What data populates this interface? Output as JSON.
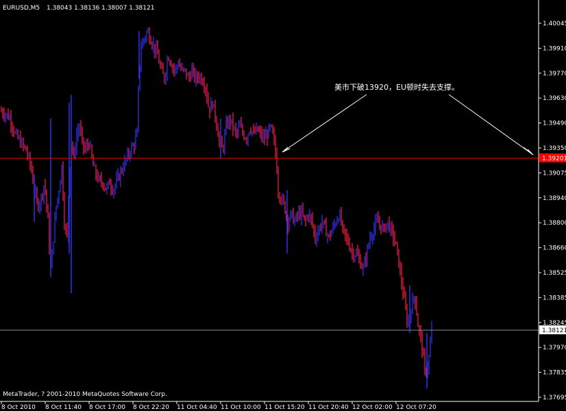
{
  "chart_data": {
    "type": "candlestick",
    "header": {
      "symbol": "EURUSD,M5",
      "quote": "1.38043 1.38136 1.38007 1.38121"
    },
    "ylim": [
      1.37695,
      1.4011
    ],
    "y_ticks": [
      "1.40045",
      "1.39910",
      "1.39770",
      "1.39630",
      "1.39490",
      "1.39350",
      "1.39075",
      "1.38940",
      "1.38800",
      "1.38660",
      "1.38525",
      "1.38385",
      "1.38245",
      "1.37970",
      "1.37835",
      "1.37695"
    ],
    "x_ticks": [
      "8 Oct 2010",
      "8 Oct 11:40",
      "8 Oct 17:00",
      "8 Oct 22:20",
      "11 Oct 04:40",
      "11 Oct 10:00",
      "11 Oct 15:20",
      "11 Oct 20:40",
      "12 Oct 02:00",
      "12 Oct 07:20"
    ],
    "support_level": {
      "value": 1.392,
      "label": "1.39201"
    },
    "current_price": {
      "value": 1.38121,
      "label": "1.38121"
    },
    "annotation": "美市下破13920，EU顿时失去支撑。",
    "copyright": "MetaTrader, ? 2001-2010 MetaQuotes Software Corp.",
    "price_path": [
      [
        0,
        1.395
      ],
      [
        8,
        1.3948
      ],
      [
        15,
        1.3945
      ],
      [
        22,
        1.3935
      ],
      [
        30,
        1.393
      ],
      [
        38,
        1.3925
      ],
      [
        45,
        1.3915
      ],
      [
        50,
        1.39
      ],
      [
        55,
        1.389
      ],
      [
        60,
        1.3895
      ],
      [
        65,
        1.3905
      ],
      [
        70,
        1.388
      ],
      [
        74,
        1.385
      ],
      [
        78,
        1.387
      ],
      [
        82,
        1.389
      ],
      [
        86,
        1.39
      ],
      [
        90,
        1.3915
      ],
      [
        94,
        1.388
      ],
      [
        98,
        1.387
      ],
      [
        101,
        1.391
      ],
      [
        104,
        1.393
      ],
      [
        108,
        1.392
      ],
      [
        112,
        1.3935
      ],
      [
        116,
        1.394
      ],
      [
        120,
        1.393
      ],
      [
        124,
        1.3925
      ],
      [
        130,
        1.393
      ],
      [
        136,
        1.3915
      ],
      [
        140,
        1.391
      ],
      [
        145,
        1.3905
      ],
      [
        150,
        1.3905
      ],
      [
        155,
        1.39
      ],
      [
        160,
        1.3905
      ],
      [
        165,
        1.39
      ],
      [
        170,
        1.3905
      ],
      [
        175,
        1.391
      ],
      [
        180,
        1.3915
      ],
      [
        185,
        1.392
      ],
      [
        190,
        1.3925
      ],
      [
        195,
        1.3928
      ],
      [
        200,
        1.3935
      ],
      [
        203,
        1.3975
      ],
      [
        206,
        1.399
      ],
      [
        210,
        1.3995
      ],
      [
        215,
        1.4
      ],
      [
        220,
        1.3995
      ],
      [
        225,
        1.399
      ],
      [
        230,
        1.3985
      ],
      [
        235,
        1.3975
      ],
      [
        240,
        1.397
      ],
      [
        245,
        1.3985
      ],
      [
        250,
        1.398
      ],
      [
        255,
        1.3975
      ],
      [
        260,
        1.398
      ],
      [
        265,
        1.3975
      ],
      [
        270,
        1.3975
      ],
      [
        275,
        1.397
      ],
      [
        280,
        1.3975
      ],
      [
        285,
        1.397
      ],
      [
        290,
        1.3972
      ],
      [
        295,
        1.397
      ],
      [
        300,
        1.3965
      ],
      [
        305,
        1.395
      ],
      [
        310,
        1.3955
      ],
      [
        315,
        1.3945
      ],
      [
        320,
        1.393
      ],
      [
        325,
        1.3925
      ],
      [
        330,
        1.394
      ],
      [
        335,
        1.3945
      ],
      [
        340,
        1.394
      ],
      [
        345,
        1.3935
      ],
      [
        350,
        1.394
      ],
      [
        355,
        1.3935
      ],
      [
        360,
        1.3933
      ],
      [
        365,
        1.394
      ],
      [
        370,
        1.3935
      ],
      [
        375,
        1.3938
      ],
      [
        380,
        1.3935
      ],
      [
        385,
        1.3932
      ],
      [
        390,
        1.3935
      ],
      [
        395,
        1.394
      ],
      [
        400,
        1.393
      ],
      [
        403,
        1.392
      ],
      [
        406,
        1.39
      ],
      [
        410,
        1.3895
      ],
      [
        415,
        1.389
      ],
      [
        420,
        1.388
      ],
      [
        425,
        1.3885
      ],
      [
        430,
        1.388
      ],
      [
        435,
        1.3885
      ],
      [
        440,
        1.3885
      ],
      [
        445,
        1.388
      ],
      [
        450,
        1.3885
      ],
      [
        455,
        1.388
      ],
      [
        460,
        1.387
      ],
      [
        465,
        1.3875
      ],
      [
        470,
        1.388
      ],
      [
        475,
        1.3875
      ],
      [
        480,
        1.387
      ],
      [
        485,
        1.3875
      ],
      [
        490,
        1.388
      ],
      [
        495,
        1.3885
      ],
      [
        500,
        1.3875
      ],
      [
        505,
        1.387
      ],
      [
        510,
        1.3865
      ],
      [
        515,
        1.386
      ],
      [
        520,
        1.386
      ],
      [
        525,
        1.3855
      ],
      [
        530,
        1.385
      ],
      [
        535,
        1.386
      ],
      [
        540,
        1.387
      ],
      [
        545,
        1.3875
      ],
      [
        550,
        1.388
      ],
      [
        555,
        1.3878
      ],
      [
        560,
        1.3875
      ],
      [
        565,
        1.388
      ],
      [
        570,
        1.3875
      ],
      [
        575,
        1.387
      ],
      [
        580,
        1.386
      ],
      [
        585,
        1.3845
      ],
      [
        590,
        1.383
      ],
      [
        595,
        1.3815
      ],
      [
        600,
        1.3825
      ],
      [
        605,
        1.3835
      ],
      [
        610,
        1.3815
      ],
      [
        615,
        1.3805
      ],
      [
        620,
        1.3785
      ],
      [
        625,
        1.379
      ],
      [
        630,
        1.3812
      ]
    ],
    "spikes": [
      [
        74,
        1.3945,
        1.3845
      ],
      [
        104,
        1.396,
        1.3835
      ],
      [
        101,
        1.3955,
        1.386
      ],
      [
        50,
        1.391,
        1.388
      ],
      [
        322,
        1.3945,
        1.392
      ],
      [
        419,
        1.39,
        1.386
      ],
      [
        203,
        1.4,
        1.397
      ],
      [
        598,
        1.384,
        1.381
      ],
      [
        623,
        1.381,
        1.3775
      ]
    ]
  }
}
